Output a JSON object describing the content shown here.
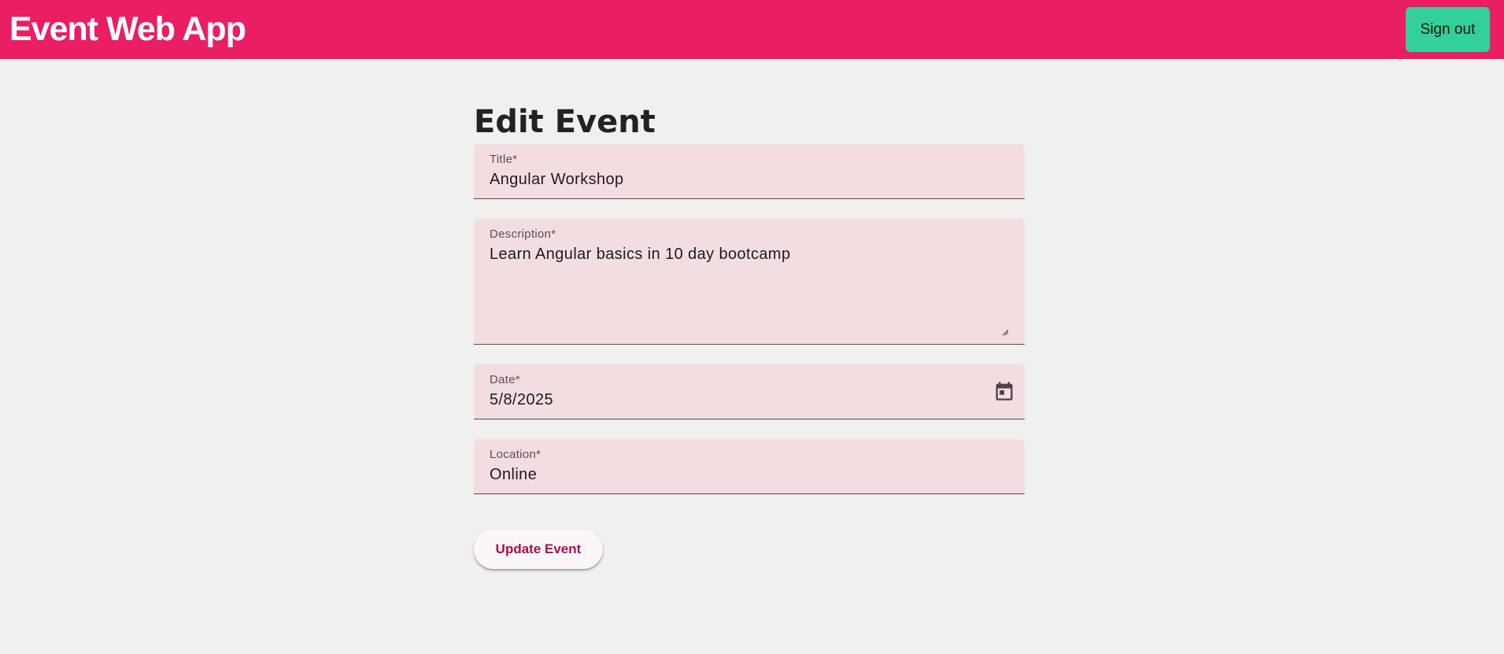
{
  "header": {
    "app_title": "Event Web App",
    "signout_label": "Sign out"
  },
  "form": {
    "heading": "Edit Event",
    "title": {
      "label": "Title*",
      "value": "Angular Workshop"
    },
    "description": {
      "label": "Description*",
      "value": "Learn Angular basics in 10 day bootcamp"
    },
    "date": {
      "label": "Date*",
      "value": "5/8/2025"
    },
    "location": {
      "label": "Location*",
      "value": "Online"
    },
    "submit_label": "Update Event"
  },
  "colors": {
    "toolbar": "#e91e63",
    "signout_button": "#32d09b",
    "field_background": "#f4dde1",
    "submit_text": "#a3114d"
  },
  "icons": {
    "date_picker": "calendar-icon",
    "textarea_resize": "resize-grip-icon"
  }
}
